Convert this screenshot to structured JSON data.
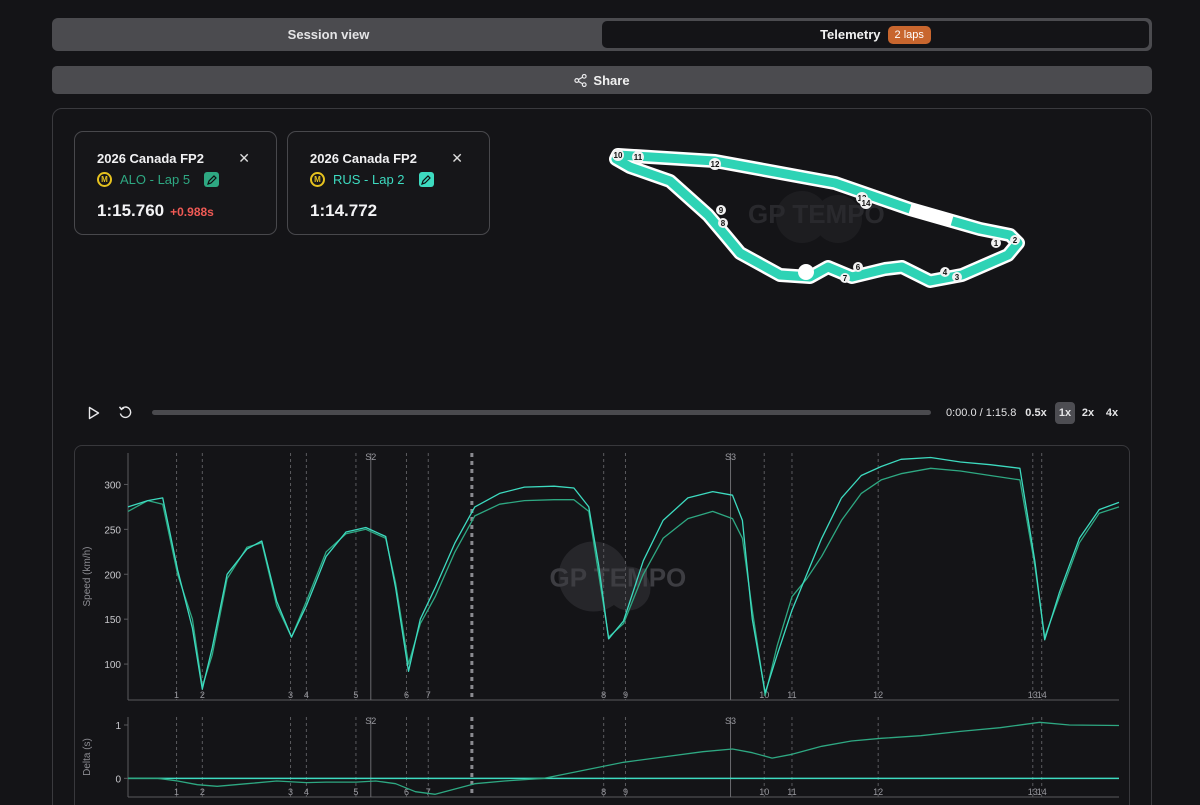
{
  "tabs": [
    {
      "label": "Session view",
      "active": false
    },
    {
      "label": "Telemetry",
      "badge": "2 laps",
      "active": true
    }
  ],
  "share_label": "Share",
  "cards": [
    {
      "title": "2026 Canada FP2",
      "team_icon": "mercedes-logo-icon",
      "driver": "ALO - Lap 5",
      "time": "1:15.760",
      "delta": "+0.988s",
      "color": "#2ea882"
    },
    {
      "title": "2026 Canada FP2",
      "team_icon": "mercedes-logo-icon",
      "driver": "RUS - Lap 2",
      "time": "1:14.772",
      "delta": "",
      "color": "#3ddbc0"
    }
  ],
  "track": {
    "turn_labels": [
      "1",
      "2",
      "3",
      "4",
      "6",
      "7",
      "8",
      "9",
      "10",
      "11",
      "12",
      "13",
      "14"
    ],
    "watermark": "GP TEMPO"
  },
  "playback": {
    "current": "0:00.0",
    "total": "1:15.8",
    "readout": "0:00.0 / 1:15.8",
    "progress": 0,
    "speeds": [
      "0.5x",
      "1x",
      "2x",
      "4x"
    ],
    "selected_speed": "1x"
  },
  "chart_data": [
    {
      "type": "line",
      "ylabel": "Speed (km/h)",
      "ylim": [
        60,
        335
      ],
      "yticks": [
        100,
        150,
        200,
        250,
        300
      ],
      "xlim": [
        0,
        100
      ],
      "sector_labels": [
        "S2",
        "S3"
      ],
      "sector_x": [
        24.5,
        60.8
      ],
      "turn_markers": [
        {
          "label": "1",
          "x": 4.9
        },
        {
          "label": "2",
          "x": 7.5
        },
        {
          "label": "3",
          "x": 16.4
        },
        {
          "label": "4",
          "x": 18.0
        },
        {
          "label": "5",
          "x": 23.0
        },
        {
          "label": "6",
          "x": 28.1
        },
        {
          "label": "7",
          "x": 30.3
        },
        {
          "label": "8",
          "x": 48.0
        },
        {
          "label": "9",
          "x": 50.2
        },
        {
          "label": "10",
          "x": 64.2
        },
        {
          "label": "11",
          "x": 67.0
        },
        {
          "label": "12",
          "x": 75.7
        },
        {
          "label": "13",
          "x": 91.3
        },
        {
          "label": "14",
          "x": 92.2
        }
      ],
      "dashed_marker_x": 34.7,
      "watermark": "GP TEMPO",
      "series": [
        {
          "color": "#2ea882",
          "x": [
            0,
            2,
            3.5,
            5,
            6.5,
            7.5,
            8.5,
            10,
            12,
            13.5,
            15,
            16.5,
            18,
            20,
            22,
            24,
            26,
            27,
            28.3,
            29.5,
            31,
            33,
            35,
            37.5,
            40,
            43,
            45,
            46.5,
            47.5,
            48.5,
            50,
            52,
            54,
            56.5,
            59,
            61,
            62,
            63,
            64.3,
            65.5,
            67,
            68.5,
            70,
            72,
            74,
            76,
            78,
            81,
            84,
            87,
            90,
            91.5,
            92.5,
            94,
            96,
            98,
            100
          ],
          "values": [
            270,
            282,
            278,
            200,
            150,
            75,
            110,
            195,
            230,
            235,
            165,
            130,
            170,
            225,
            245,
            250,
            240,
            190,
            100,
            145,
            175,
            225,
            265,
            278,
            282,
            283,
            283,
            270,
            200,
            130,
            145,
            200,
            240,
            262,
            270,
            262,
            240,
            160,
            65,
            120,
            175,
            195,
            220,
            260,
            290,
            305,
            312,
            318,
            315,
            310,
            305,
            210,
            130,
            175,
            235,
            268,
            275
          ]
        },
        {
          "color": "#3ddbc0",
          "x": [
            0,
            2,
            3.5,
            5,
            6.5,
            7.5,
            8.5,
            10,
            12,
            13.5,
            15,
            16.5,
            18,
            20,
            22,
            24,
            26,
            27,
            28.3,
            29.5,
            31,
            33,
            35,
            37.5,
            40,
            43,
            45,
            46.5,
            47.5,
            48.5,
            50,
            52,
            54,
            56.5,
            59,
            61,
            62,
            63,
            64.3,
            65.5,
            67,
            68.5,
            70,
            72,
            74,
            76,
            78,
            81,
            84,
            87,
            90,
            91.5,
            92.5,
            94,
            96,
            98,
            100
          ],
          "values": [
            275,
            282,
            285,
            205,
            140,
            72,
            118,
            200,
            228,
            237,
            170,
            130,
            165,
            220,
            247,
            252,
            242,
            185,
            92,
            150,
            185,
            235,
            275,
            290,
            297,
            298,
            296,
            275,
            210,
            128,
            148,
            215,
            260,
            285,
            292,
            288,
            260,
            150,
            68,
            110,
            160,
            200,
            240,
            285,
            310,
            320,
            328,
            330,
            325,
            322,
            318,
            215,
            127,
            180,
            240,
            272,
            280
          ]
        }
      ]
    },
    {
      "type": "line",
      "ylabel": "Delta (s)",
      "ylim": [
        -0.35,
        1.15
      ],
      "yticks": [
        0,
        1
      ],
      "xlim": [
        0,
        100
      ],
      "sector_labels": [
        "S2",
        "S3"
      ],
      "sector_x": [
        24.5,
        60.8
      ],
      "series": [
        {
          "color": "#2ea882",
          "x": [
            0,
            3,
            5,
            7,
            9,
            12,
            15,
            18,
            20,
            23,
            25,
            27,
            29,
            31,
            33,
            35,
            38,
            42,
            46,
            50,
            54,
            58,
            61,
            63,
            65,
            67,
            70,
            73,
            76,
            80,
            84,
            88,
            92,
            95,
            100
          ],
          "values": [
            0,
            0,
            -0.05,
            -0.12,
            -0.15,
            -0.1,
            -0.05,
            -0.08,
            -0.07,
            -0.07,
            -0.05,
            -0.1,
            -0.25,
            -0.3,
            -0.2,
            -0.1,
            -0.05,
            0.0,
            0.15,
            0.3,
            0.4,
            0.5,
            0.55,
            0.48,
            0.38,
            0.45,
            0.6,
            0.7,
            0.75,
            0.8,
            0.88,
            0.95,
            1.05,
            1.0,
            0.99
          ]
        }
      ]
    }
  ]
}
